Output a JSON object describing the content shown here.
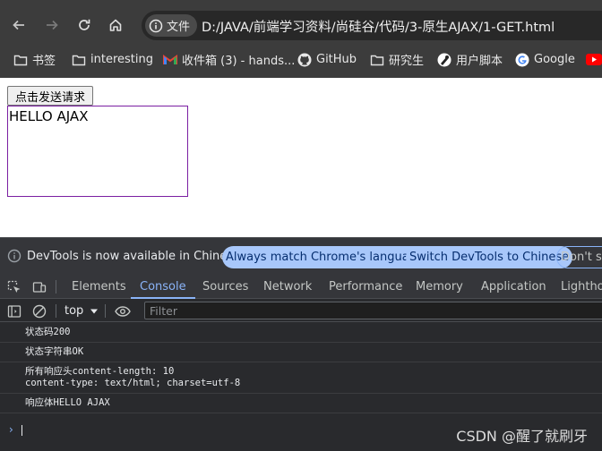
{
  "browser": {
    "site_chip_label": "文件",
    "url": "D:/JAVA/前端学习资料/尚硅谷/代码/3-原生AJAX/1-GET.html"
  },
  "bookmarks": [
    {
      "label": "书签",
      "icon": "folder-icon"
    },
    {
      "label": "interesting",
      "icon": "folder-icon"
    },
    {
      "label": "收件箱 (3) - hands...",
      "icon": "gmail-icon"
    },
    {
      "label": "GitHub",
      "icon": "github-icon"
    },
    {
      "label": "研究生",
      "icon": "folder-icon"
    },
    {
      "label": "用户脚本",
      "icon": "userscript-icon"
    },
    {
      "label": "Google",
      "icon": "google-icon"
    }
  ],
  "page": {
    "button_label": "点击发送请求",
    "result_text": "HELLO AJAX"
  },
  "devtools": {
    "info_text": "DevTools is now available in Chinese!",
    "btn_match_language": "Always match Chrome's language",
    "btn_switch_chinese": "Switch DevTools to Chinese",
    "btn_dont_show": "Don't sh",
    "tabs": [
      "Elements",
      "Console",
      "Sources",
      "Network",
      "Performance",
      "Memory",
      "Application",
      "Lighthou"
    ],
    "active_tab": "Console",
    "context": "top",
    "filter_placeholder": "Filter",
    "log": [
      "状态码200",
      "状态字符串OK",
      "所有响应头content-length: 10\ncontent-type: text/html; charset=utf-8",
      "响应体HELLO AJAX"
    ]
  },
  "watermark": "CSDN @醒了就刷牙"
}
